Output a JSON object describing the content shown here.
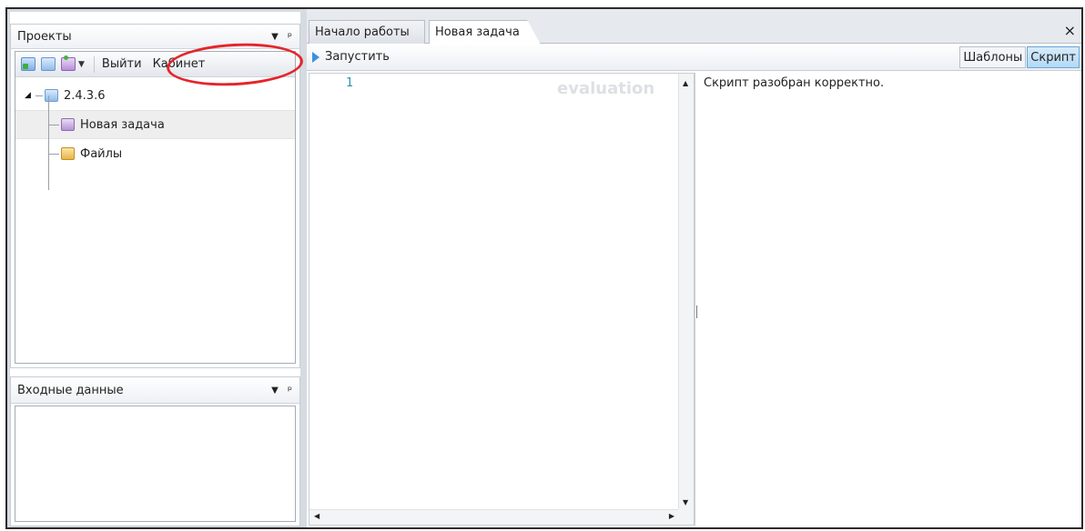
{
  "left": {
    "projects_panel": {
      "title": "Проекты",
      "dropdown_glyph": "▼",
      "pin_glyph": "ᵖ",
      "toolbar": {
        "icons": [
          "add-project-icon",
          "open-project-icon",
          "add-task-icon"
        ],
        "exit_label": "Выйти",
        "cabinet_label": "Кабинет"
      },
      "tree": {
        "root": {
          "label": "2.4.3.6",
          "icon": "project-icon",
          "expanded": true
        },
        "children": [
          {
            "label": "Новая задача",
            "icon": "task-icon",
            "selected": true
          },
          {
            "label": "Файлы",
            "icon": "folder-icon",
            "selected": false
          }
        ]
      }
    },
    "input_panel": {
      "title": "Входные данные",
      "dropdown_glyph": "▼",
      "pin_glyph": "ᵖ"
    }
  },
  "tabs": {
    "items": [
      {
        "label": "Начало работы",
        "active": false
      },
      {
        "label": "Новая задача",
        "active": true
      }
    ],
    "close_glyph": "×"
  },
  "actionbar": {
    "run_label": "Запустить",
    "templates_label": "Шаблоны",
    "script_label": "Скрипт",
    "script_active": true
  },
  "editor": {
    "line_number": "1",
    "watermark": "evaluation"
  },
  "output": {
    "message": "Скрипт разобран корректно."
  },
  "colors": {
    "accent": "#3f8fe0",
    "annotation": "#e5252a",
    "selected_row": "#eeeeee",
    "line_number": "#2b91af"
  }
}
